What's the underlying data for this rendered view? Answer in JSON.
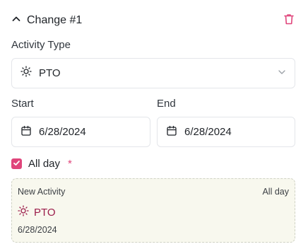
{
  "header": {
    "title": "Change #1",
    "collapse_icon": "chevron-up-icon",
    "delete_icon": "trash-icon"
  },
  "activity_type": {
    "label": "Activity Type",
    "value": "PTO",
    "icon": "sun-icon",
    "dropdown_icon": "chevron-down-icon"
  },
  "start": {
    "label": "Start",
    "value": "6/28/2024",
    "icon": "calendar-icon"
  },
  "end": {
    "label": "End",
    "value": "6/28/2024",
    "icon": "calendar-icon"
  },
  "all_day": {
    "label": "All day",
    "required_marker": "*",
    "checked": true
  },
  "preview": {
    "title": "New Activity",
    "all_day_label": "All day",
    "activity": "PTO",
    "activity_icon": "sun-icon",
    "date": "6/28/2024"
  },
  "colors": {
    "accent": "#e0457b",
    "preview_activity": "#9b1c4a",
    "preview_bg": "#f8f8ee"
  }
}
